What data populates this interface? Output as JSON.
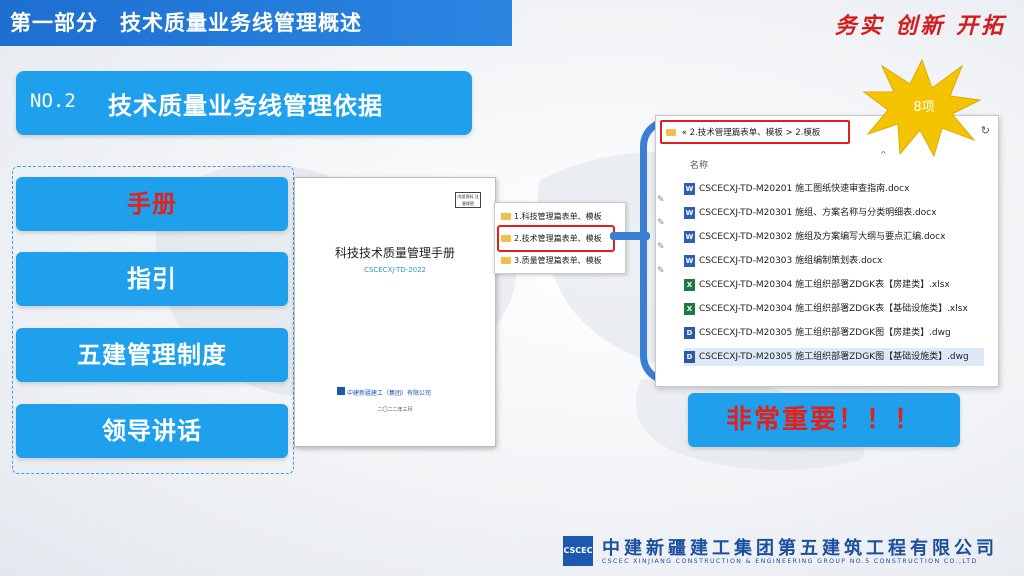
{
  "header": {
    "title": "第一部分　技术质量业务线管理概述",
    "slogan": "务实 创新 开拓"
  },
  "section": {
    "number": "NO.2",
    "title": "技术质量业务线管理依据"
  },
  "categories": [
    {
      "label": "手册",
      "highlight_color": "#e3201a"
    },
    {
      "label": "指引"
    },
    {
      "label": "五建管理制度"
    },
    {
      "label": "领导讲话"
    }
  ],
  "document": {
    "title": "科技技术质量管理手册",
    "code": "CSCECXJ-TD-2022",
    "stamp": "内部资料 注意保密",
    "company": "中建新疆建工（集团）有限公司",
    "date": "二〇二二年三月"
  },
  "folders": [
    {
      "label": "1.科技管理篇表单、模板"
    },
    {
      "label": "2.技术管理篇表单、模板"
    },
    {
      "label": "3.质量管理篇表单、模板"
    }
  ],
  "explorer": {
    "path_prefix": "«",
    "path": "2.技术管理篇表单、模板",
    "path_sep": ">",
    "path_current": "2.模板",
    "column_name": "名称",
    "files": [
      {
        "name": "CSCECXJ-TD-M20201 施工图纸快速审查指南.docx",
        "icon": "word-icon",
        "type": "W"
      },
      {
        "name": "CSCECXJ-TD-M20301 施组、方案名称与分类明细表.docx",
        "icon": "word-icon",
        "type": "W"
      },
      {
        "name": "CSCECXJ-TD-M20302 施组及方案编写大纲与要点汇编.docx",
        "icon": "word-icon",
        "type": "W"
      },
      {
        "name": "CSCECXJ-TD-M20303 施组编制策划表.docx",
        "icon": "word-icon",
        "type": "W"
      },
      {
        "name": "CSCECXJ-TD-M20304 施工组织部署ZDGK表【房建类】.xlsx",
        "icon": "excel-icon",
        "type": "X"
      },
      {
        "name": "CSCECXJ-TD-M20304 施工组织部署ZDGK表【基础设施类】.xlsx",
        "icon": "excel-icon",
        "type": "X"
      },
      {
        "name": "CSCECXJ-TD-M20305 施工组织部署ZDGK图【房建类】.dwg",
        "icon": "dwg-icon",
        "type": "D"
      },
      {
        "name": "CSCECXJ-TD-M20305 施工组织部署ZDGK图【基础设施类】.dwg",
        "icon": "dwg-icon",
        "type": "D"
      }
    ]
  },
  "burst": {
    "label": "8项",
    "color": "#f5c400"
  },
  "important": {
    "label": "非常重要！！！"
  },
  "footer": {
    "logo_text": "CSCEC",
    "company_cn": "中建新疆建工集团第五建筑工程有限公司",
    "company_en": "CSCEC XINJIANG CONSTRUCTION & ENGINEERING GROUP NO.5 CONSTRUCTION CO.,LTD"
  },
  "colors": {
    "primary": "#1ea0ec",
    "accent_red": "#e3201a",
    "title_bar": "#1e6fcf",
    "footer_blue": "#1c4f9e"
  }
}
